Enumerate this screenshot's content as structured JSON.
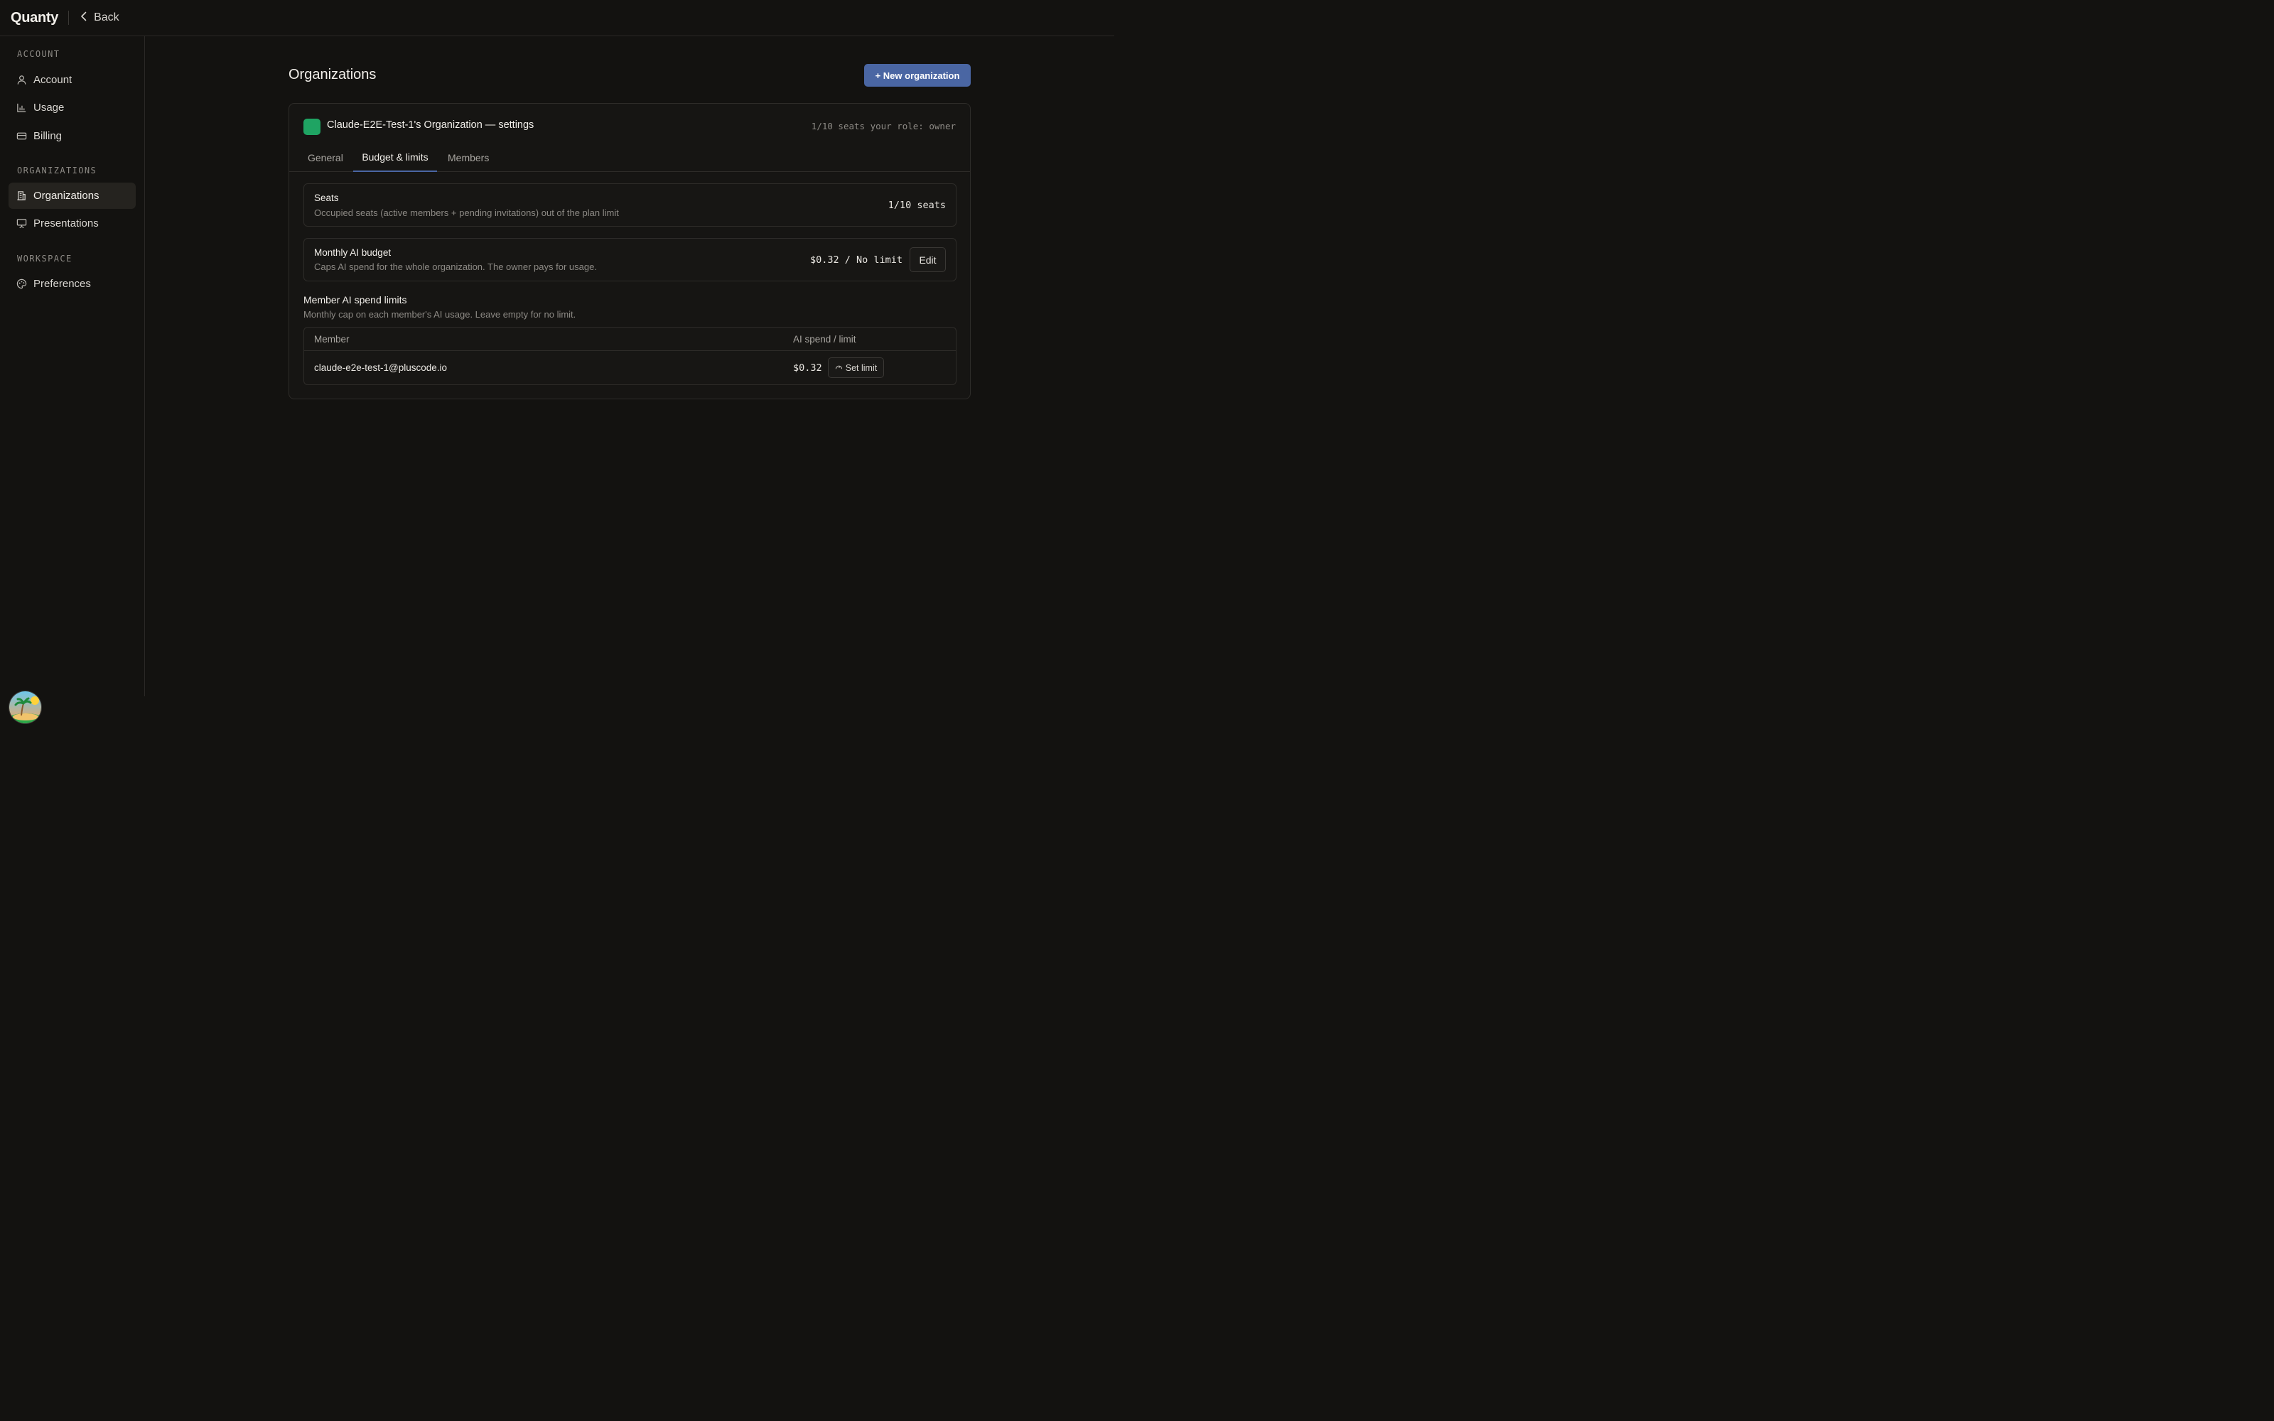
{
  "app": {
    "logo": "Quanty",
    "back_label": "Back"
  },
  "sidebar": {
    "sections": [
      {
        "label": "ACCOUNT"
      },
      {
        "label": "ORGANIZATIONS"
      },
      {
        "label": "WORKSPACE"
      }
    ],
    "items": [
      {
        "label": "Account",
        "icon": "user-icon"
      },
      {
        "label": "Usage",
        "icon": "bar-chart-icon"
      },
      {
        "label": "Billing",
        "icon": "credit-card-icon"
      },
      {
        "label": "Organizations",
        "icon": "building-icon",
        "active": true
      },
      {
        "label": "Presentations",
        "icon": "presentation-icon"
      },
      {
        "label": "Preferences",
        "icon": "palette-icon"
      }
    ]
  },
  "main": {
    "title": "Organizations",
    "new_org_label": "+ New organization",
    "org": {
      "name": "Claude-E2E-Test-1's Organization — settings",
      "meta": "1/10 seats your role: owner",
      "swatch_color": "#1fa463",
      "tabs": [
        {
          "label": "General"
        },
        {
          "label": "Budget & limits",
          "active": true
        },
        {
          "label": "Members"
        }
      ],
      "seats": {
        "title": "Seats",
        "desc": "Occupied seats (active members + pending invitations) out of the plan limit",
        "value": "1/10 seats"
      },
      "budget": {
        "title": "Monthly AI budget",
        "desc": "Caps AI spend for the whole organization. The owner pays for usage.",
        "value": "$0.32 / No limit",
        "edit_label": "Edit"
      },
      "member_limits": {
        "title": "Member AI spend limits",
        "desc": "Monthly cap on each member's AI usage. Leave empty for no limit.",
        "columns": [
          "Member",
          "AI spend / limit"
        ],
        "rows": [
          {
            "member": "claude-e2e-test-1@pluscode.io",
            "spend": "$0.32",
            "action": "Set limit"
          }
        ]
      }
    }
  },
  "colors": {
    "accent": "#4a66a3",
    "background": "#131210",
    "swatch": "#1fa463"
  }
}
